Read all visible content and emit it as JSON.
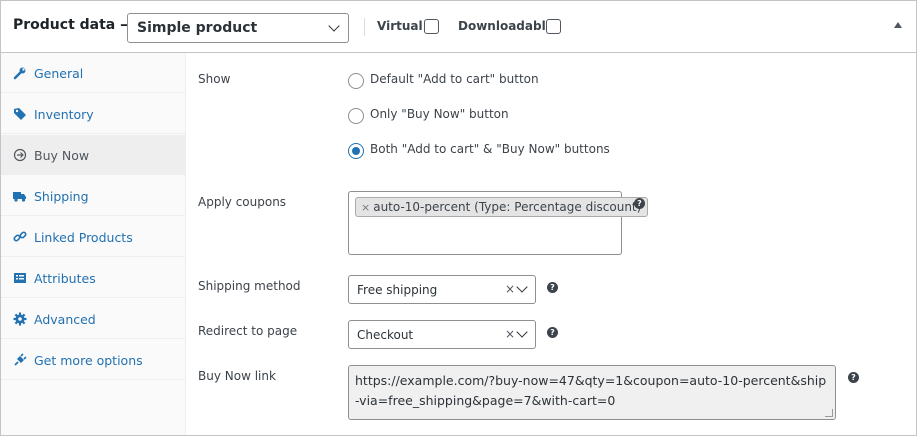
{
  "header": {
    "title": "Product data —",
    "product_type": "Simple product",
    "virtual_label": "Virtual:",
    "downloadable_label": "Downloadable:"
  },
  "sidebar": {
    "items": [
      {
        "label": "General",
        "icon": "wrench-icon"
      },
      {
        "label": "Inventory",
        "icon": "tag-icon"
      },
      {
        "label": "Buy Now",
        "icon": "arrow-circle-icon",
        "active": true
      },
      {
        "label": "Shipping",
        "icon": "truck-icon"
      },
      {
        "label": "Linked Products",
        "icon": "link-icon"
      },
      {
        "label": "Attributes",
        "icon": "list-icon"
      },
      {
        "label": "Advanced",
        "icon": "gear-icon"
      },
      {
        "label": "Get more options",
        "icon": "plugin-icon"
      }
    ]
  },
  "buy_now": {
    "show": {
      "label": "Show",
      "options": [
        "Default \"Add to cart\" button",
        "Only \"Buy Now\" button",
        "Both \"Add to cart\" & \"Buy Now\" buttons"
      ],
      "selected_index": 2
    },
    "coupons": {
      "label": "Apply coupons",
      "tags": [
        "auto-10-percent (Type: Percentage discount)"
      ],
      "remove_glyph": "×"
    },
    "shipping": {
      "label": "Shipping method",
      "value": "Free shipping",
      "clear_glyph": "×"
    },
    "redirect": {
      "label": "Redirect to page",
      "value": "Checkout",
      "clear_glyph": "×"
    },
    "link": {
      "label": "Buy Now link",
      "value": "https://example.com/?buy-now=47&qty=1&coupon=auto-10-percent&ship-via=free_shipping&page=7&with-cart=0"
    },
    "help_glyph": "?"
  },
  "colors": {
    "accent": "#2271b1",
    "border": "#c3c4c7",
    "sidebar_bg": "#fafafa",
    "active_tab_bg": "#eeeeee"
  }
}
